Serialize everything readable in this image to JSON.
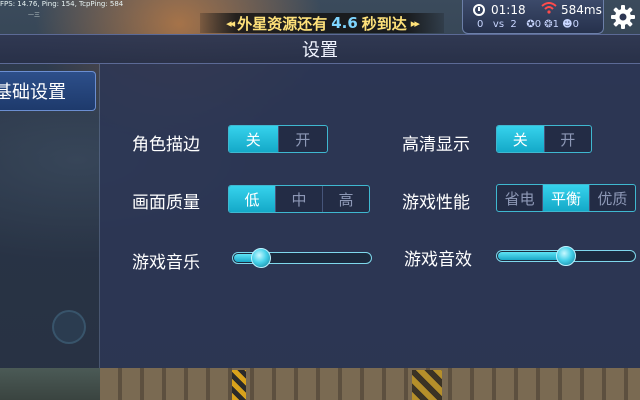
{
  "hud": {
    "fps_text": "FPS: 14.76, Ping: 154, TcpPing: 584",
    "fps_sub": "一三",
    "announcement": {
      "left_arrows": "◂◂",
      "prefix": "外星资源还有",
      "number": "4.6",
      "suffix": "秒到达",
      "right_arrows": "▸▸"
    },
    "time": "01:18",
    "ping": "584ms",
    "score_left": "0",
    "vs": "vs",
    "score_right": "2",
    "score_icons": "✪0 ❂1 ☻0",
    "clock_icon": "clock-icon",
    "wifi_icon": "wifi-signal-icon",
    "gear_icon": "settings-gear-icon"
  },
  "settings": {
    "title": "设置",
    "tab_basic": "基础设置",
    "rows": {
      "outline": {
        "label": "角色描边",
        "options": [
          "关",
          "开"
        ],
        "selected": 0
      },
      "hd": {
        "label": "高清显示",
        "options": [
          "关",
          "开"
        ],
        "selected": 0
      },
      "quality": {
        "label": "画面质量",
        "options": [
          "低",
          "中",
          "高"
        ],
        "selected": 0
      },
      "perf": {
        "label": "游戏性能",
        "options": [
          "省电",
          "平衡",
          "优质"
        ],
        "selected": 1
      },
      "music": {
        "label": "游戏音乐",
        "value": 0.2
      },
      "sfx": {
        "label": "游戏音效",
        "value": 0.5
      }
    }
  },
  "colors": {
    "accent": "#1fb9d6",
    "panel": "#2c3654",
    "announce_text": "#ffe27a",
    "ping_warning": "#ff4b4b"
  }
}
